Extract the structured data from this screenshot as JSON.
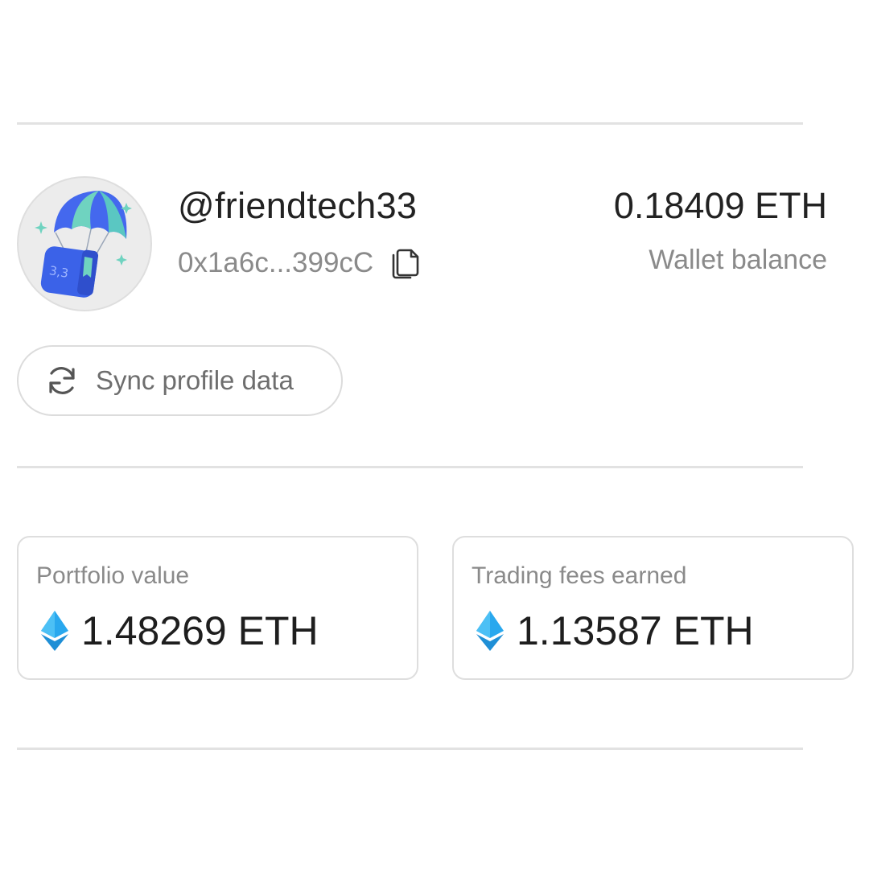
{
  "profile": {
    "username": "@friendtech33",
    "address": "0x1a6c...399cC",
    "avatar_badge": "3,3"
  },
  "wallet": {
    "balance": "0.18409 ETH",
    "label": "Wallet balance"
  },
  "actions": {
    "sync_label": "Sync profile data"
  },
  "stats": [
    {
      "label": "Portfolio value",
      "value": "1.48269 ETH"
    },
    {
      "label": "Trading fees earned",
      "value": "1.13587 ETH"
    }
  ],
  "icons": {
    "copy": "copy-icon",
    "sync": "refresh-icon",
    "eth": "ethereum-icon",
    "avatar": "parachute-box-icon"
  },
  "colors": {
    "eth_accent": "#29a8ee",
    "text_primary": "#222222",
    "text_secondary": "#8a8a8a",
    "divider": "#e2e2e2",
    "avatar_blue": "#3b62e8",
    "avatar_teal": "#6fd3c0"
  }
}
